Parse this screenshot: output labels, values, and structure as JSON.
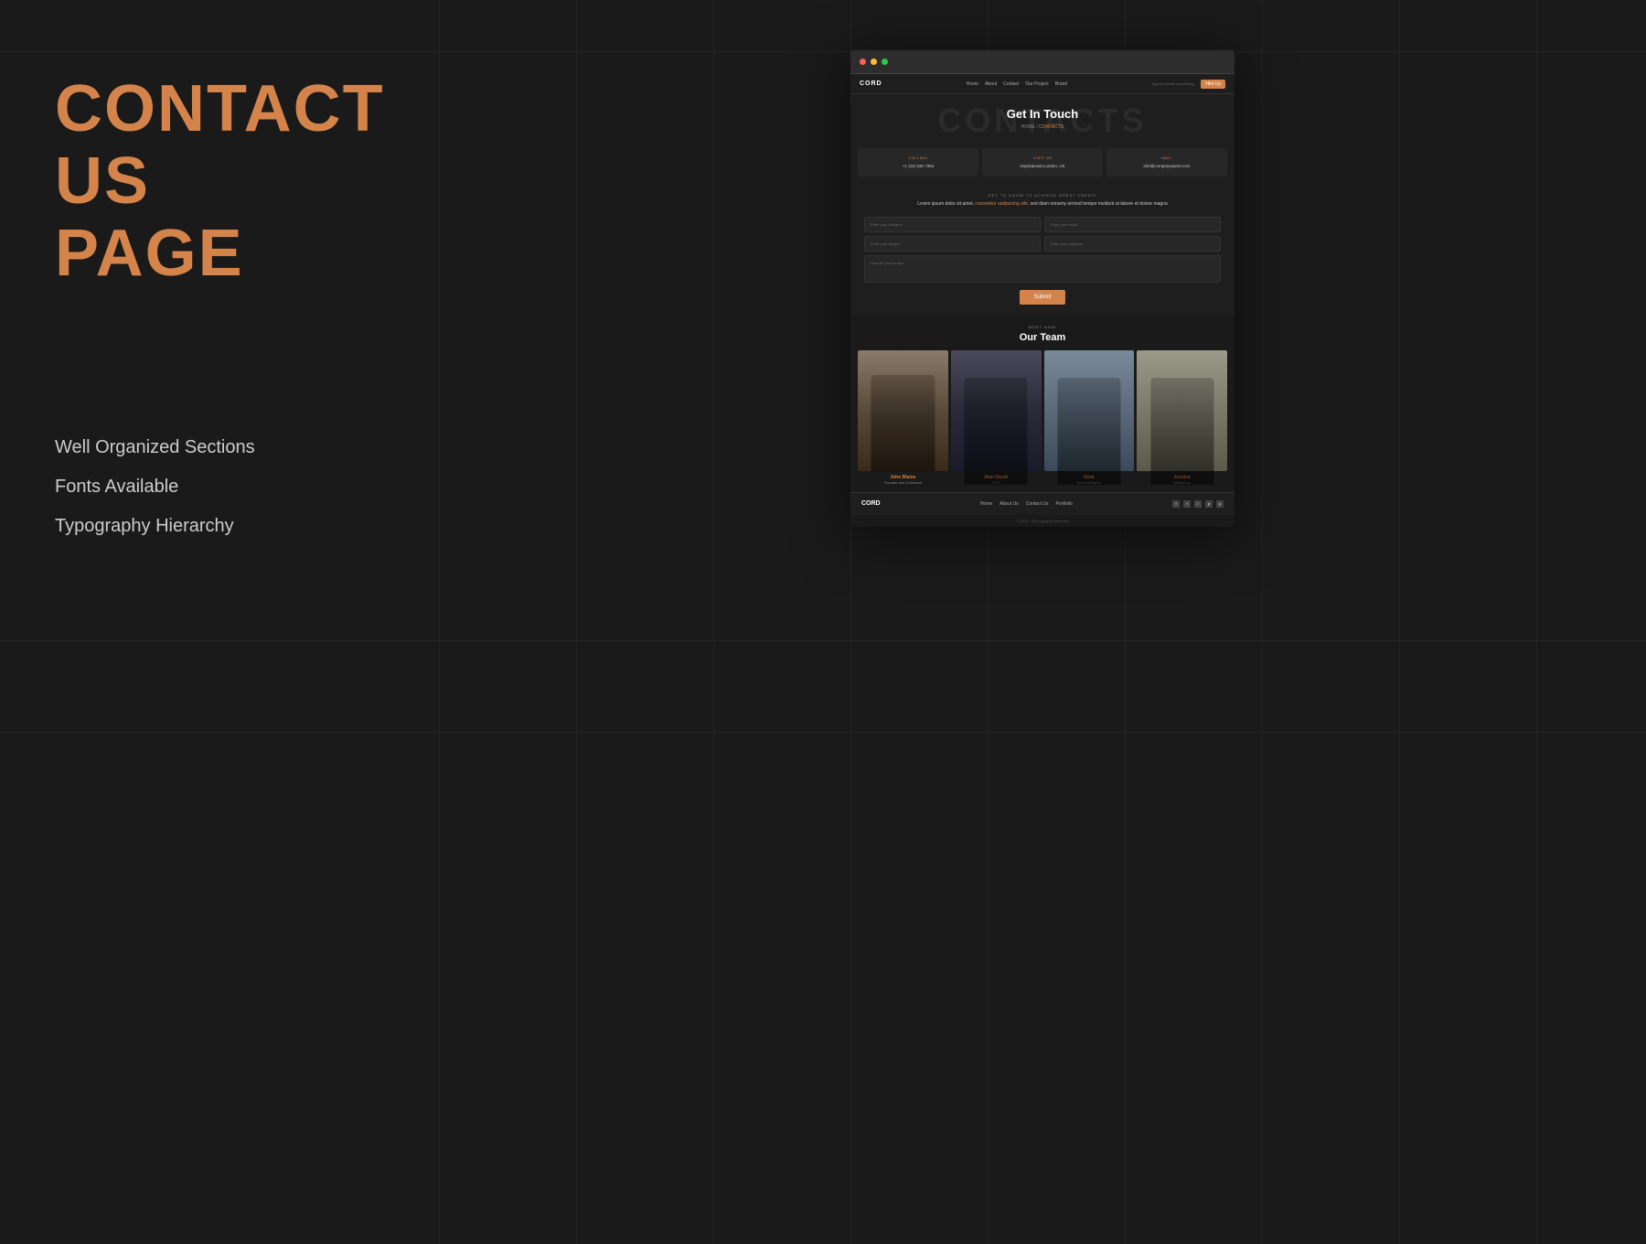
{
  "page": {
    "background": "#1a1a1a"
  },
  "left_panel": {
    "main_title_line1": "CONTACT US",
    "main_title_line2": "PAGE",
    "features": [
      "Well Organized Sections",
      "Fonts Available",
      "Typography Hierarchy"
    ]
  },
  "preview": {
    "nav": {
      "logo": "CORD",
      "links": [
        "Home",
        "About",
        "Contact",
        "Our Project",
        "Brand"
      ],
      "search_placeholder": "Type to search something...",
      "cta_button": "Hire Us"
    },
    "hero": {
      "bg_text": "CONTACTS",
      "title": "Get In Touch",
      "breadcrumb_home": "HOME",
      "breadcrumb_sep": "/",
      "breadcrumb_current": "CONTACTS"
    },
    "contact_cards": [
      {
        "label": "Calling",
        "value": "+1 (22) 345 7394"
      },
      {
        "label": "Visit Us",
        "value": "Inspirational London, UK"
      },
      {
        "label": "Mail",
        "value": "info@companyname.com"
      }
    ],
    "form_section": {
      "sub_label": "GET TO KNOW TO ACHIEVE GREAT CREDIT",
      "body_text_plain": "Lorem ipsum dolor sit amet, ",
      "body_text_highlight": "consetetur sadipscing elitr,",
      "body_text_end": " sed diam nonumy eirmod tempor invidunt ut labore et dolore magna",
      "fields": [
        {
          "placeholder": "Enter your fullname",
          "type": "text"
        },
        {
          "placeholder": "Enter your email",
          "type": "text"
        },
        {
          "placeholder": "Enter your budget",
          "type": "text"
        },
        {
          "placeholder": "Enter your business",
          "type": "text"
        },
        {
          "placeholder": "How did you contact",
          "type": "textarea"
        }
      ],
      "submit_label": "Submit"
    },
    "team": {
      "sub_label": "Meet Now",
      "title": "Our Team",
      "members": [
        {
          "name": "John Blaise",
          "role": "Founder and Chairman",
          "photo_class": "member1"
        },
        {
          "name": "Alan David",
          "role": "CEO",
          "photo_class": "member2"
        },
        {
          "name": "Dora",
          "role": "Head Designer",
          "photo_class": "member3"
        },
        {
          "name": "Jessica",
          "role": "#lifstyle.pc",
          "photo_class": "member4"
        }
      ]
    },
    "footer": {
      "logo": "CORD",
      "nav_links": [
        "Home",
        "About Us",
        "Contact Us",
        "Portfolio"
      ],
      "social_icons": [
        "f",
        "t",
        "i",
        "p",
        "y"
      ],
      "copyright": "© 2025 - All copyrights reserved"
    }
  }
}
